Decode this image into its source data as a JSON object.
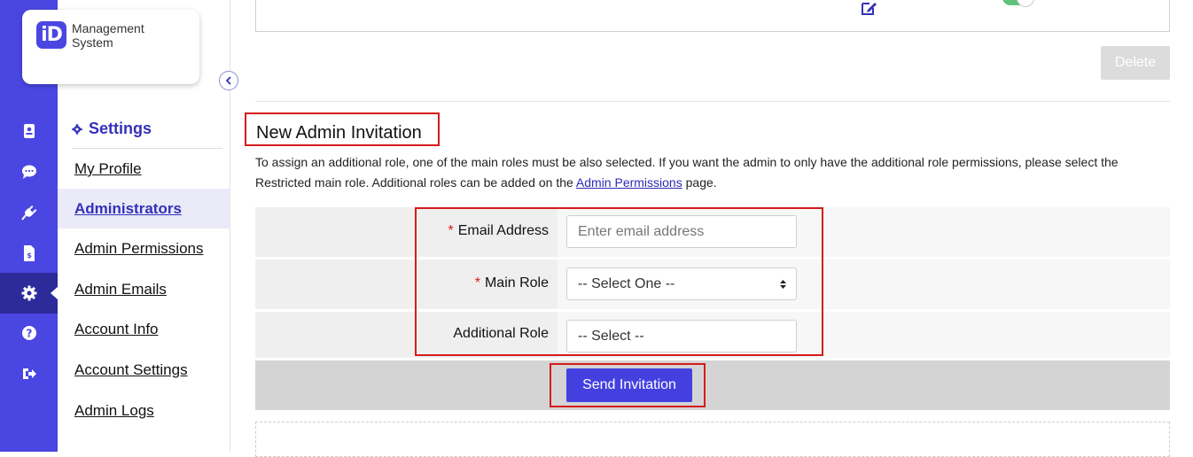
{
  "logo": {
    "badge": "iD",
    "line1": "Management",
    "line2": "System"
  },
  "rail": {
    "icons": [
      "id-card-icon",
      "chat-icon",
      "plug-icon",
      "invoice-icon",
      "gear-icon",
      "help-icon",
      "logout-icon"
    ],
    "active": "gear-icon",
    "color": "#4a46e2"
  },
  "sidebar": {
    "title": "Settings",
    "items": [
      {
        "label": "My Profile",
        "active": false
      },
      {
        "label": "Administrators",
        "active": true
      },
      {
        "label": "Admin Permissions",
        "active": false
      },
      {
        "label": "Admin Emails",
        "active": false
      },
      {
        "label": "Account Info",
        "active": false
      },
      {
        "label": "Account Settings",
        "active": false
      },
      {
        "label": "Admin Logs",
        "active": false
      }
    ]
  },
  "toolbar": {
    "delete_label": "Delete"
  },
  "invitation": {
    "title": "New Admin Invitation",
    "description_before": "To assign an additional role, one of the main roles must be also selected. If you want the admin to only have the additional role permissions, please select the Restricted main role. Additional roles can be added on the ",
    "description_link": "Admin Permissions",
    "description_after": " page.",
    "email_label": "Email Address",
    "email_placeholder": "Enter email address",
    "main_role_label": "Main Role",
    "main_role_value": "-- Select One --",
    "additional_role_label": "Additional Role",
    "additional_role_value": "-- Select --",
    "required_mark": "*",
    "send_label": "Send Invitation"
  },
  "colors": {
    "accent": "#4440e0",
    "highlight": "#d61b1b",
    "nav_active": "#3430b8"
  }
}
